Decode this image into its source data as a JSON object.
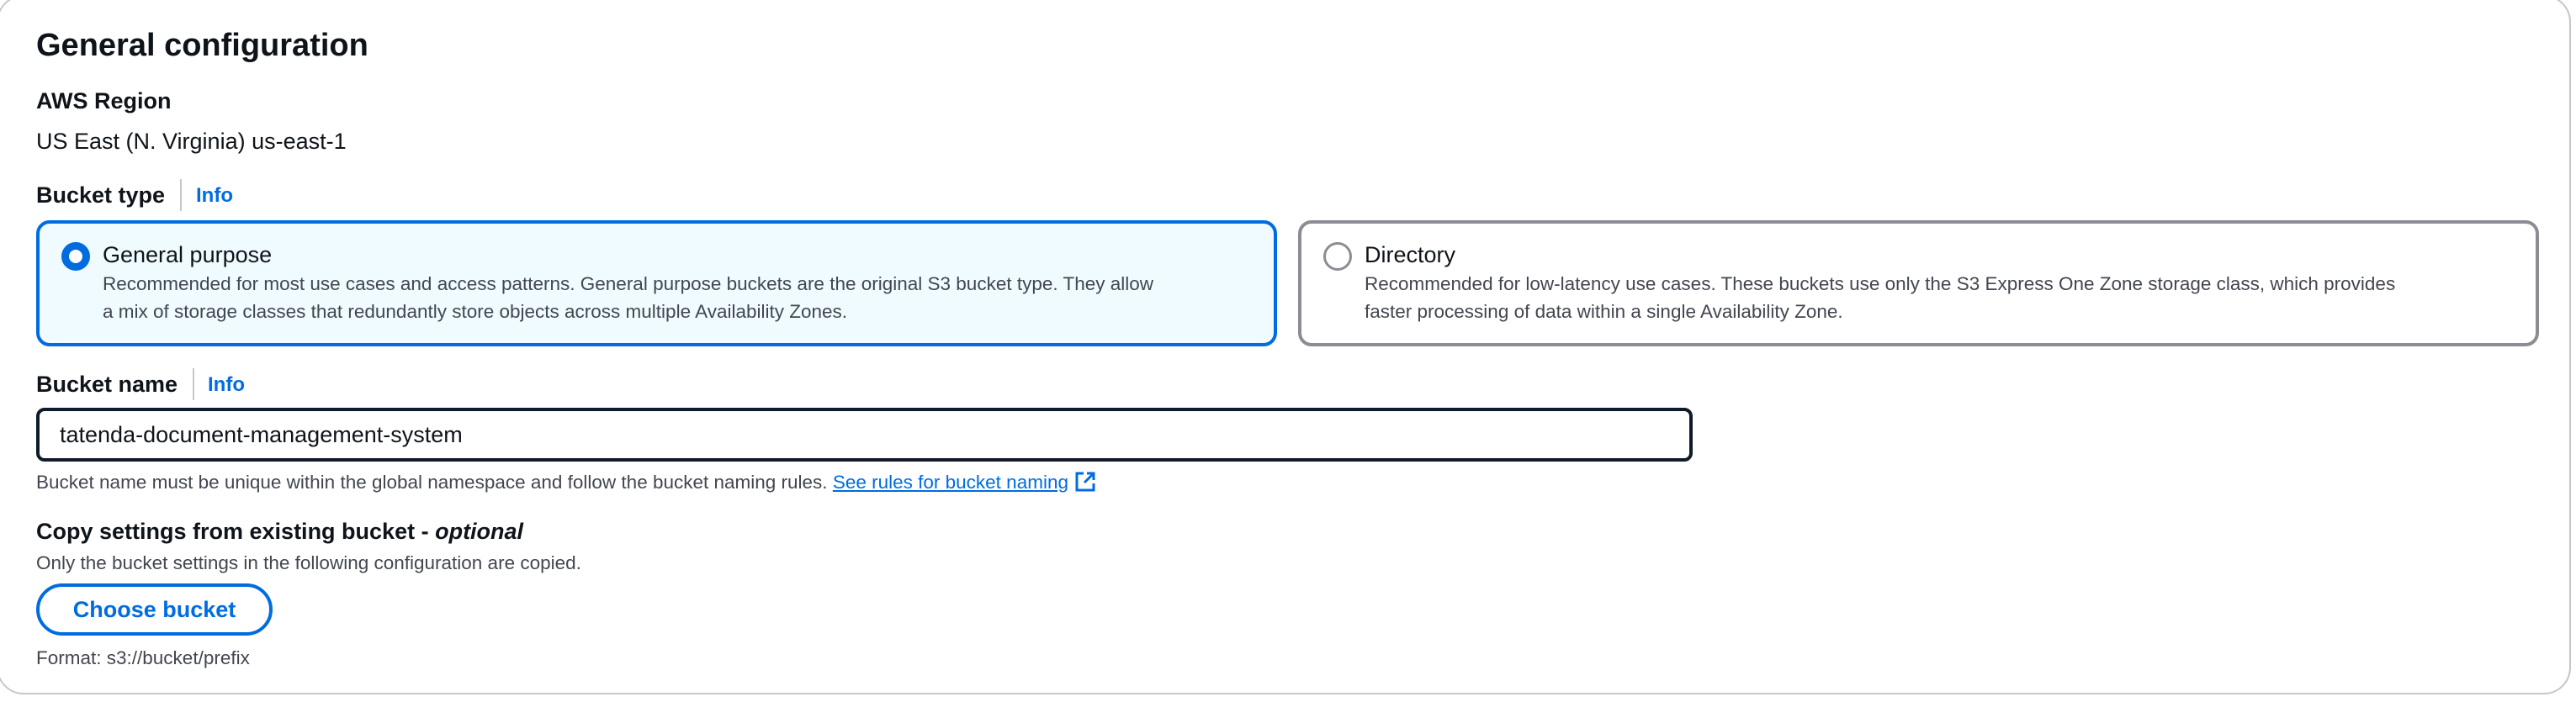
{
  "section": {
    "title": "General configuration"
  },
  "region": {
    "label": "AWS Region",
    "value": "US East (N. Virginia) us-east-1"
  },
  "bucket_type": {
    "label": "Bucket type",
    "info": "Info",
    "options": [
      {
        "title": "General purpose",
        "desc_line1": "Recommended for most use cases and access patterns. General purpose buckets are the original S3 bucket type. They allow",
        "desc_line2": "a mix of storage classes that redundantly store objects across multiple Availability Zones.",
        "selected": true
      },
      {
        "title": "Directory",
        "desc_line1": "Recommended for low-latency use cases. These buckets use only the S3 Express One Zone storage class, which provides",
        "desc_line2": "faster processing of data within a single Availability Zone.",
        "selected": false
      }
    ]
  },
  "bucket_name": {
    "label": "Bucket name",
    "info": "Info",
    "value": "tatenda-document-management-system",
    "hint": "Bucket name must be unique within the global namespace and follow the bucket naming rules.",
    "rules_link": "See rules for bucket naming",
    "rules_icon": "external-link-icon"
  },
  "copy_settings": {
    "label": "Copy settings from existing bucket - ",
    "label_optional": "optional",
    "description": "Only the bucket settings in the following configuration are copied.",
    "button": "Choose bucket",
    "format_hint": "Format: s3://bucket/prefix"
  },
  "colors": {
    "accent": "#006ce0",
    "selected_bg": "#f0fbff",
    "border": "#8c8c94"
  }
}
